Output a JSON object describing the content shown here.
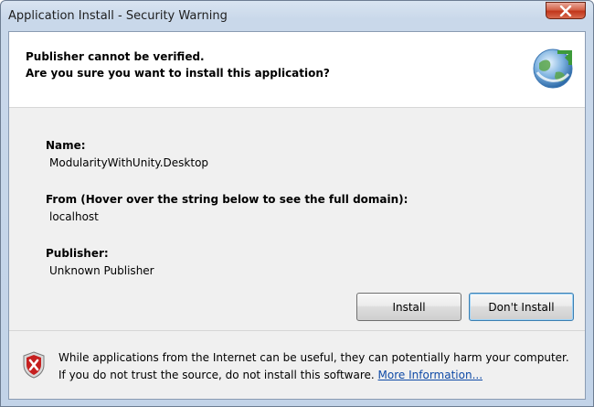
{
  "window": {
    "title": "Application Install - Security Warning"
  },
  "header": {
    "line1": "Publisher cannot be verified.",
    "line2": "Are you sure you want to install this application?",
    "icon": "globe-install-icon"
  },
  "details": {
    "name_label": "Name:",
    "name_value": "ModularityWithUnity.Desktop",
    "from_label": "From (Hover over the string below to see the full domain):",
    "from_value": "localhost",
    "publisher_label": "Publisher:",
    "publisher_value": "Unknown Publisher"
  },
  "buttons": {
    "install": "Install",
    "dont_install": "Don't Install"
  },
  "footer": {
    "icon": "shield-warning-icon",
    "text": "While applications from the Internet can be useful, they can potentially harm your computer. If you do not trust the source, do not install this software.",
    "link": "More Information..."
  },
  "colors": {
    "link": "#0f4aa6",
    "close_button": "#c2361b",
    "shield": "#c62020"
  }
}
